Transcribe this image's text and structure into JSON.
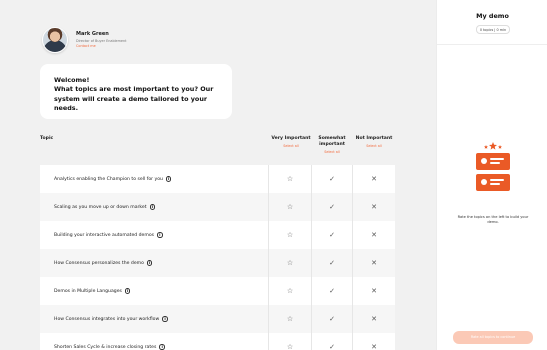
{
  "rep": {
    "name": "Mark Green",
    "title": "Director of Buyer Enablement",
    "link": "Contact me"
  },
  "welcome": {
    "title": "Welcome!",
    "body": "What topics are most important to you? Our system will create a demo tailored to your needs."
  },
  "table": {
    "topic_header": "Topic",
    "columns": [
      {
        "label": "Very Important",
        "select": "Select all"
      },
      {
        "label": "Somewhat important",
        "select": "Select all"
      },
      {
        "label": "Not Important",
        "select": "Select all"
      }
    ],
    "rows": [
      {
        "label": "Analytics enabling the Champion to sell for you",
        "info": "i",
        "c1": "☆",
        "c2": "✓",
        "c3": "✕"
      },
      {
        "label": "Scaling as you move up or down market",
        "info": "i",
        "c1": "☆",
        "c2": "✓",
        "c3": "✕"
      },
      {
        "label": "Building your interactive automated demos",
        "info": "i",
        "c1": "☆",
        "c2": "✓",
        "c3": "✕"
      },
      {
        "label": "How Consensus personalizes the demo",
        "info": "i",
        "c1": "☆",
        "c2": "✓",
        "c3": "✕"
      },
      {
        "label": "Demos in Multiple Languages",
        "info": "i",
        "c1": "☆",
        "c2": "✓",
        "c3": "✕"
      },
      {
        "label": "How Consensus integrates into your workflow",
        "info": "i",
        "c1": "☆",
        "c2": "✓",
        "c3": "✕"
      },
      {
        "label": "Shorten Sales Cycle & increase closing rates",
        "info": "i",
        "c1": "☆",
        "c2": "✓",
        "c3": "✕"
      }
    ]
  },
  "sidebar": {
    "title": "My demo",
    "badge": "0 topics | 0 min",
    "hint": "Rate the topics on the left to build your demo.",
    "button": "Rate all topics to continue"
  },
  "colors": {
    "accent": "#f26a3d",
    "illustration": "#ea5a26",
    "button_disabled": "#fbc9b6"
  },
  "icons": {
    "info": "info-icon",
    "very_important": "star-icon",
    "somewhat_important": "check-icon",
    "not_important": "x-icon"
  }
}
